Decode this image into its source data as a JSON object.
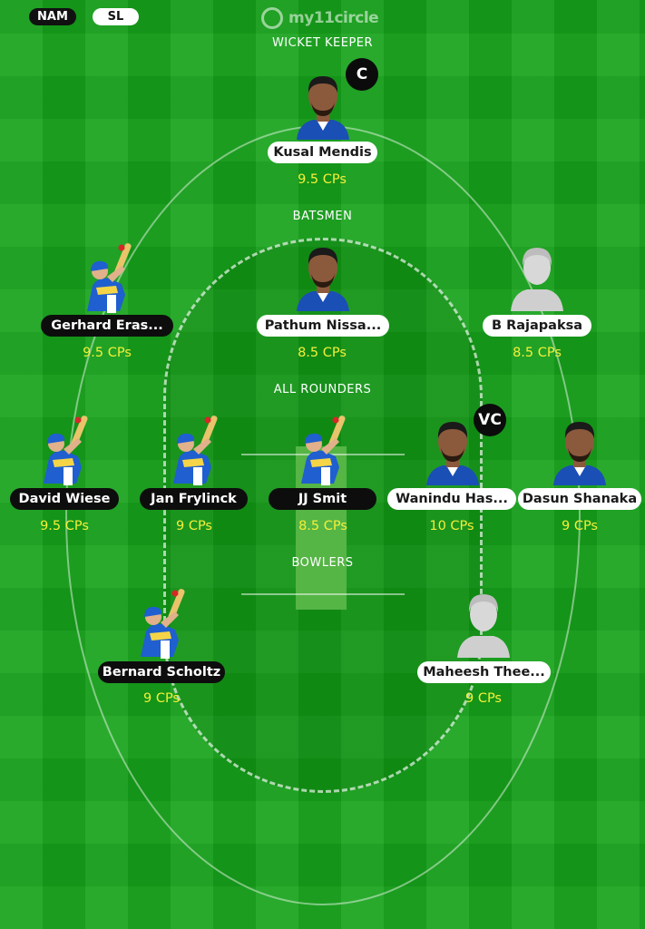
{
  "teams": {
    "left": "NAM",
    "right": "SL"
  },
  "brand": {
    "logo_text": "my11circle"
  },
  "sections": {
    "wicket_keeper": "WICKET KEEPER",
    "batsmen": "BATSMEN",
    "all_rounders": "ALL ROUNDERS",
    "bowlers": "BOWLERS"
  },
  "players": {
    "kusal_mendis": {
      "name": "Kusal Mendis",
      "credits": "9.5 CPs",
      "badge": "C"
    },
    "gerhard_erasmus": {
      "name": "Gerhard Eras...",
      "credits": "9.5 CPs"
    },
    "pathum_nissanka": {
      "name": "Pathum Nissa...",
      "credits": "8.5 CPs"
    },
    "b_rajapaksa": {
      "name": "B Rajapaksa",
      "credits": "8.5 CPs"
    },
    "david_wiese": {
      "name": "David Wiese",
      "credits": "9.5 CPs"
    },
    "jan_frylinck": {
      "name": "Jan Frylinck",
      "credits": "9 CPs"
    },
    "jj_smit": {
      "name": "JJ Smit",
      "credits": "8.5 CPs"
    },
    "wanindu_hasaranga": {
      "name": "Wanindu Has...",
      "credits": "10 CPs",
      "badge": "VC"
    },
    "dasun_shanaka": {
      "name": "Dasun Shanaka",
      "credits": "9 CPs"
    },
    "bernard_scholtz": {
      "name": "Bernard Scholtz",
      "credits": "9 CPs"
    },
    "maheesh_theekshana": {
      "name": "Maheesh Thee...",
      "credits": "9 CPs"
    }
  },
  "colors": {
    "field": "#16a21a",
    "credits": "#f3ef3a",
    "nam_jersey": "#1f5fd0",
    "sl_jersey": "#1a4fb5"
  }
}
